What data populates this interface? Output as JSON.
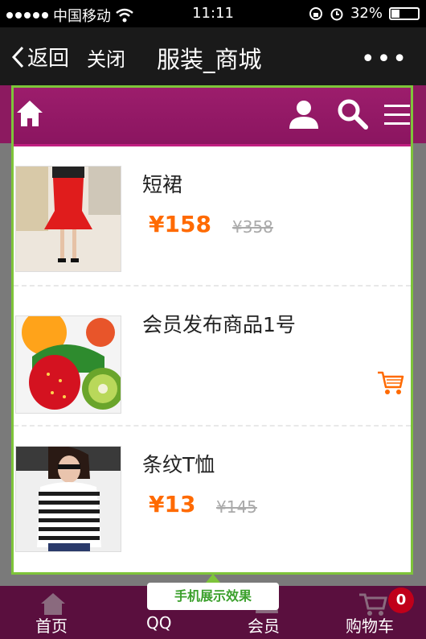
{
  "status_bar": {
    "carrier": "中国移动",
    "time": "11:11",
    "battery": "32%"
  },
  "nav": {
    "back_label": "返回",
    "close_label": "关闭",
    "title": "服装_商城",
    "more_label": "•••"
  },
  "colors": {
    "brand": "#8c1a60",
    "price": "#ff6a00",
    "frame": "#7ec43a",
    "cart_icon": "#ff6a00"
  },
  "header_icons": [
    "home-icon",
    "user-icon",
    "search-icon",
    "menu-icon"
  ],
  "products": [
    {
      "name": "短裙",
      "price": "¥158",
      "old_price": "¥358"
    },
    {
      "name": "会员发布商品1号",
      "price": "",
      "old_price": ""
    },
    {
      "name": "条纹T恤",
      "price": "¥13",
      "old_price": "¥145"
    }
  ],
  "tooltip": "手机展示效果",
  "bottom_nav": {
    "home": "首页",
    "qq": "QQ",
    "member": "会员",
    "cart": "购物车",
    "cart_count": "0"
  }
}
